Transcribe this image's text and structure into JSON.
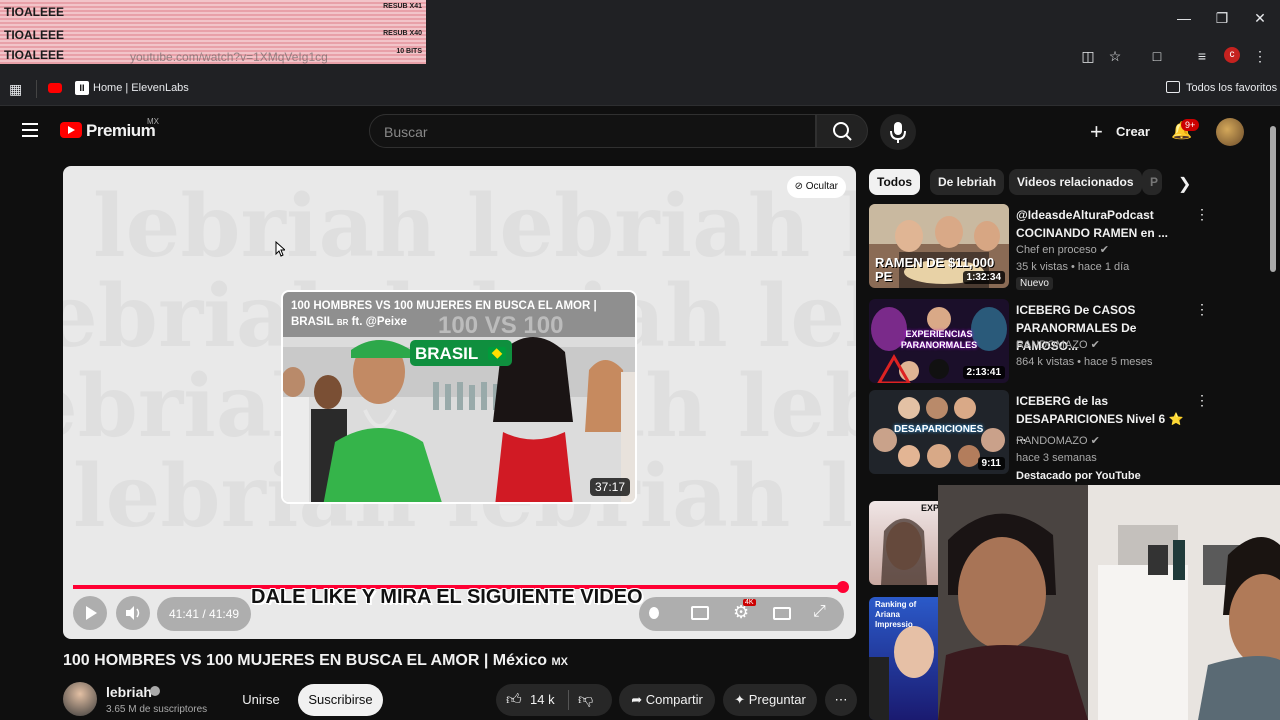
{
  "overlay": {
    "rows": [
      {
        "name": "TIOALEEE",
        "right": "RESUB X41"
      },
      {
        "name": "TIOALEEE",
        "right": "RESUB X40"
      },
      {
        "name": "TIOALEEE",
        "right": "10 BITS"
      }
    ],
    "url_ghost": "youtube.com/watch?v=1XMqVeIg1cg"
  },
  "bookmarks": {
    "item1": "Home | ElevenLabs",
    "all": "Todos los favoritos"
  },
  "header": {
    "logo": "Premium",
    "region": "MX",
    "search_placeholder": "Buscar",
    "create": "Crear",
    "notif_count": "9+"
  },
  "player": {
    "hide": "Ocultar",
    "endcard_title_1": "100 HOMBRES VS 100 MUJERES EN BUSCA EL AMOR |",
    "endcard_title_2a": "BRASIL",
    "endcard_title_2b": "BR",
    "endcard_title_2c": "ft. @Peixe",
    "endcard_banner": "BRASIL",
    "endcard_duration": "37:17",
    "time": "41:41 / 41:49",
    "caption": "DALE LIKE Y MIRA EL SIGUIENTE VIDEO",
    "progress": 1.0,
    "hd_badge": "4K"
  },
  "video": {
    "title_main": "100 HOMBRES VS 100 MUJERES EN BUSCA EL AMOR | México",
    "title_region": "MX",
    "channel": "lebriah",
    "subscribers": "3.65 M de suscriptores",
    "join": "Unirse",
    "subscribe": "Suscribirse",
    "likes": "14 k",
    "share": "Compartir",
    "ask": "Preguntar"
  },
  "chips": [
    "Todos",
    "De lebriah",
    "Videos relacionados",
    "P"
  ],
  "recs": [
    {
      "title": "@IdeasdeAlturaPodcast COCINANDO RAMEN en ...",
      "channel": "Chef en proceso",
      "meta": "35 k vistas • hace 1 día",
      "badge": "Nuevo",
      "duration": "1:32:34",
      "thumb_text": "RAMEN DE $11,000 PE"
    },
    {
      "title": "ICEBERG De CASOS PARANORMALES De FAMOSO...",
      "channel": "RANDOMAZO",
      "meta": "864 k vistas • hace 5 meses",
      "duration": "2:13:41",
      "thumb_text": "EXPERIENCIAS PARANORMALES"
    },
    {
      "title": "ICEBERG de las DESAPARICIONES Nivel 6 ⭐ ...",
      "channel": "RANDOMAZO",
      "meta": "hace 3 semanas",
      "extra": "Destacado por YouTube",
      "duration": "9:11",
      "thumb_text": "DESAPARICIONES"
    }
  ],
  "partial_thumbs": [
    "EXP",
    "Ranking of Ariana Impressio"
  ]
}
